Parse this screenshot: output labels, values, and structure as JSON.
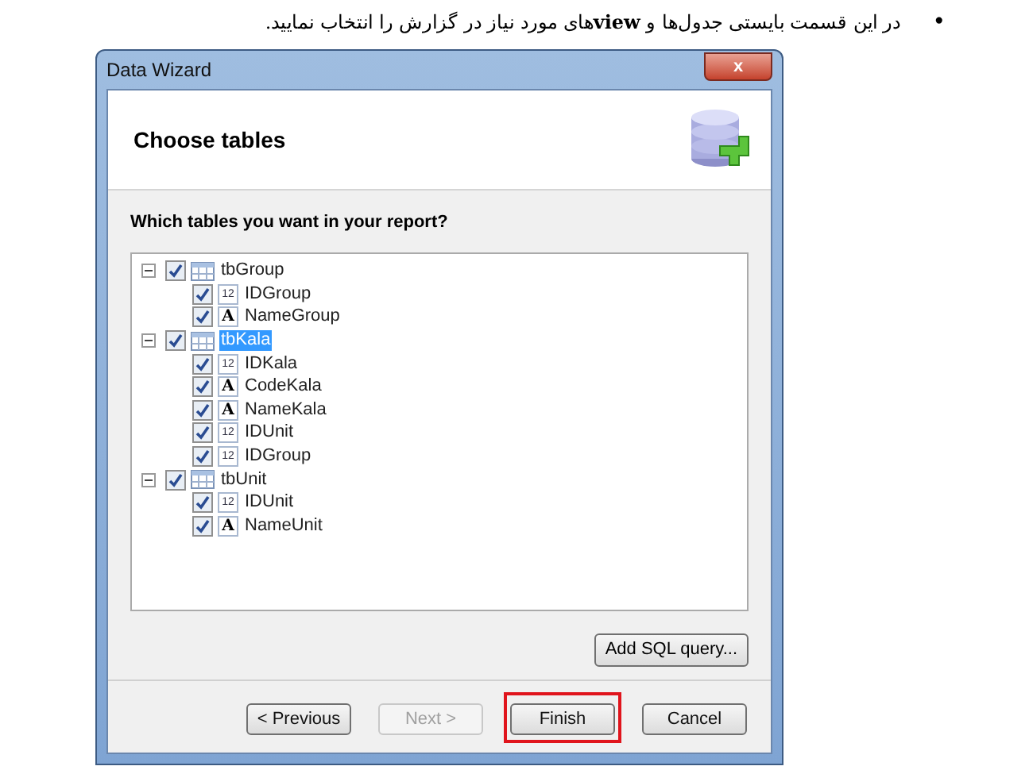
{
  "note": {
    "bullet": "•",
    "text": "در این قسمت بایستی جدول‌ها و **view**های مورد نیاز در گزارش را انتخاب نمایید."
  },
  "window": {
    "title": "Data Wizard",
    "close": "x"
  },
  "header": {
    "title": "Choose tables"
  },
  "prompt": "Which tables you want in your report?",
  "tree": [
    {
      "kind": "table",
      "label": "tbGroup",
      "checked": true,
      "expanded": true,
      "selected": false,
      "children": [
        {
          "kind": "number",
          "type_label": "12",
          "label": "IDGroup",
          "checked": true,
          "selected": false
        },
        {
          "kind": "text",
          "type_label": "A",
          "label": "NameGroup",
          "checked": true,
          "selected": false
        }
      ]
    },
    {
      "kind": "table",
      "label": "tbKala",
      "checked": true,
      "expanded": true,
      "selected": true,
      "children": [
        {
          "kind": "number",
          "type_label": "12",
          "label": "IDKala",
          "checked": true,
          "selected": false
        },
        {
          "kind": "text",
          "type_label": "A",
          "label": "CodeKala",
          "checked": true,
          "selected": false
        },
        {
          "kind": "text",
          "type_label": "A",
          "label": "NameKala",
          "checked": true,
          "selected": false
        },
        {
          "kind": "number",
          "type_label": "12",
          "label": "IDUnit",
          "checked": true,
          "selected": false
        },
        {
          "kind": "number",
          "type_label": "12",
          "label": "IDGroup",
          "checked": true,
          "selected": false
        }
      ]
    },
    {
      "kind": "table",
      "label": "tbUnit",
      "checked": true,
      "expanded": true,
      "selected": false,
      "children": [
        {
          "kind": "number",
          "type_label": "12",
          "label": "IDUnit",
          "checked": true,
          "selected": false
        },
        {
          "kind": "text",
          "type_label": "A",
          "label": "NameUnit",
          "checked": true,
          "selected": false
        }
      ]
    }
  ],
  "add_sql_button": "Add SQL query...",
  "buttons": [
    {
      "label": "< Previous",
      "disabled": false,
      "highlighted": false
    },
    {
      "label": "Next >",
      "disabled": true,
      "highlighted": false
    },
    {
      "label": "Finish",
      "disabled": false,
      "highlighted": true
    },
    {
      "label": "Cancel",
      "disabled": false,
      "highlighted": false
    }
  ]
}
